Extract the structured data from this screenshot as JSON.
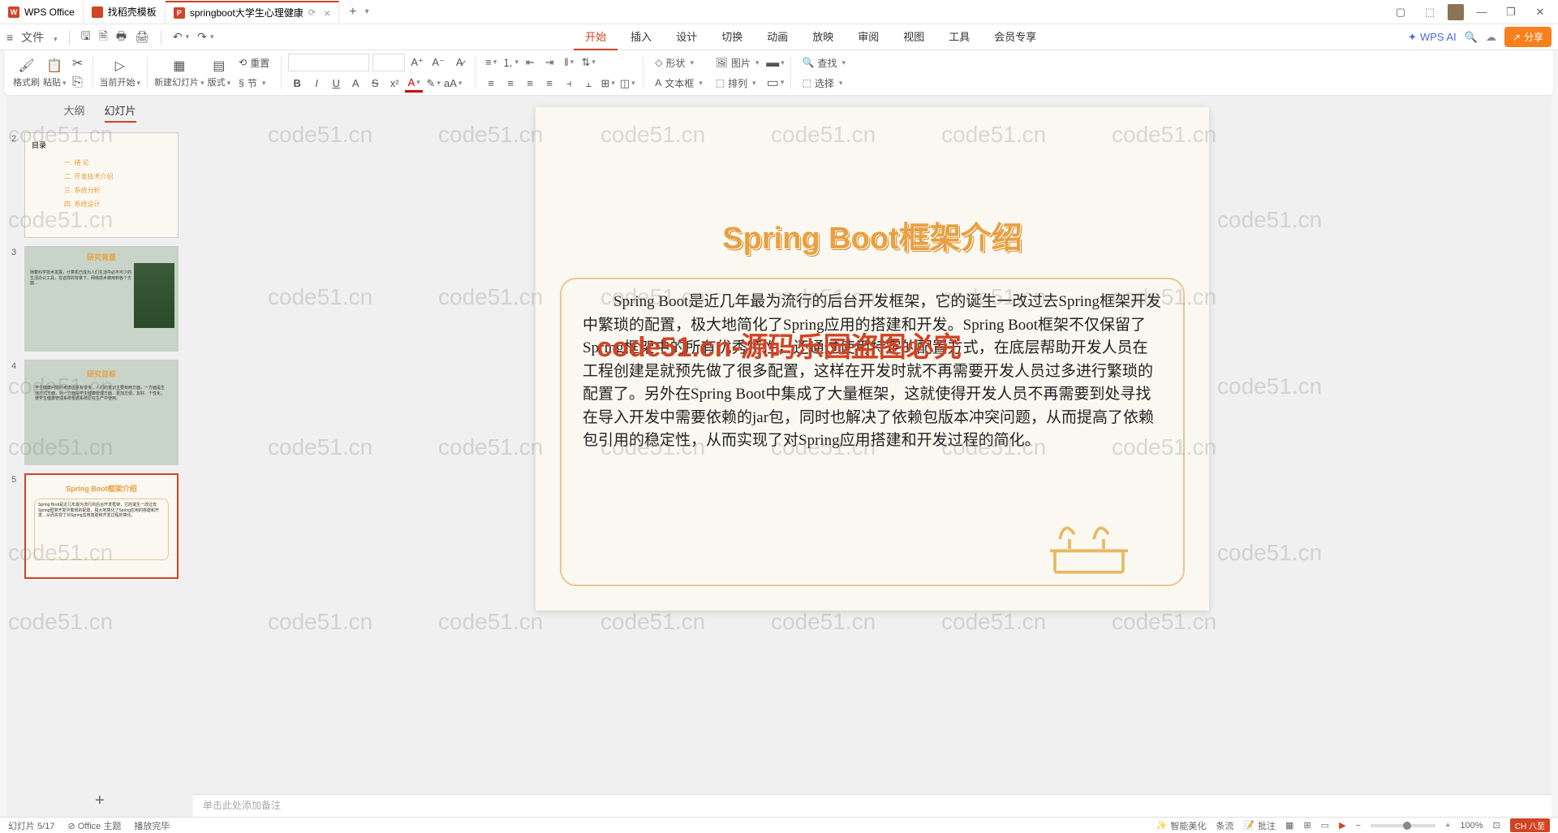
{
  "tabs": {
    "wps": "WPS Office",
    "template": "找稻壳模板",
    "doc": "springboot大学生心理健康",
    "add_label": "+"
  },
  "qat": {
    "menu": "文件"
  },
  "ribbon_tabs": [
    "开始",
    "插入",
    "设计",
    "切换",
    "动画",
    "放映",
    "审阅",
    "视图",
    "工具",
    "会员专享"
  ],
  "wps_ai": "WPS AI",
  "share": "分享",
  "ribbon": {
    "format_painter": "格式刷",
    "paste": "粘贴",
    "start_current": "当前开始",
    "new_slide": "新建幻灯片",
    "layout": "版式",
    "section": "节",
    "reset": "重置",
    "shape": "形状",
    "textbox": "文本框",
    "picture": "图片",
    "arrange": "排列",
    "find": "查找",
    "select": "选择"
  },
  "side_tabs": {
    "outline": "大纲",
    "slides": "幻灯片"
  },
  "thumbs": {
    "t2_title": "目录",
    "t2_items": [
      "一. 绪 论",
      "二. 开发技术介绍",
      "三. 系统分析",
      "四. 系统设计"
    ],
    "t3_title": "研究背景",
    "t4_title": "研究目标",
    "t5_title": "Spring Boot框架介绍"
  },
  "slide": {
    "title": "Spring Boot框架介绍",
    "body": "Spring Boot是近几年最为流行的后台开发框架，它的诞生一改过去Spring框架开发中繁琐的配置，极大地简化了Spring应用的搭建和开发。Spring Boot框架不仅保留了Spring框架中的所有优秀特性，还通过使用特定的配置方式，在底层帮助开发人员在工程创建是就预先做了很多配置，这样在开发时就不再需要开发人员过多进行繁琐的配置了。另外在Spring Boot中集成了大量框架，这就使得开发人员不再需要到处寻找在导入开发中需要依赖的jar包，同时也解决了依赖包版本冲突问题，从而提高了依赖包引用的稳定性，从而实现了对Spring应用搭建和开发过程的简化。"
  },
  "notes_placeholder": "单击此处添加备注",
  "status": {
    "slide_pos": "幻灯片 5/17",
    "office": "⊘ Office 主题",
    "playback": "播放完毕",
    "beautify": "智能美化",
    "cond": "条流",
    "notes": "批注",
    "zoom": "100%",
    "ime": "CH 八至"
  },
  "watermark_text": "code51.cn",
  "watermark_red": "code51.cn-源码乐园盗图必究"
}
